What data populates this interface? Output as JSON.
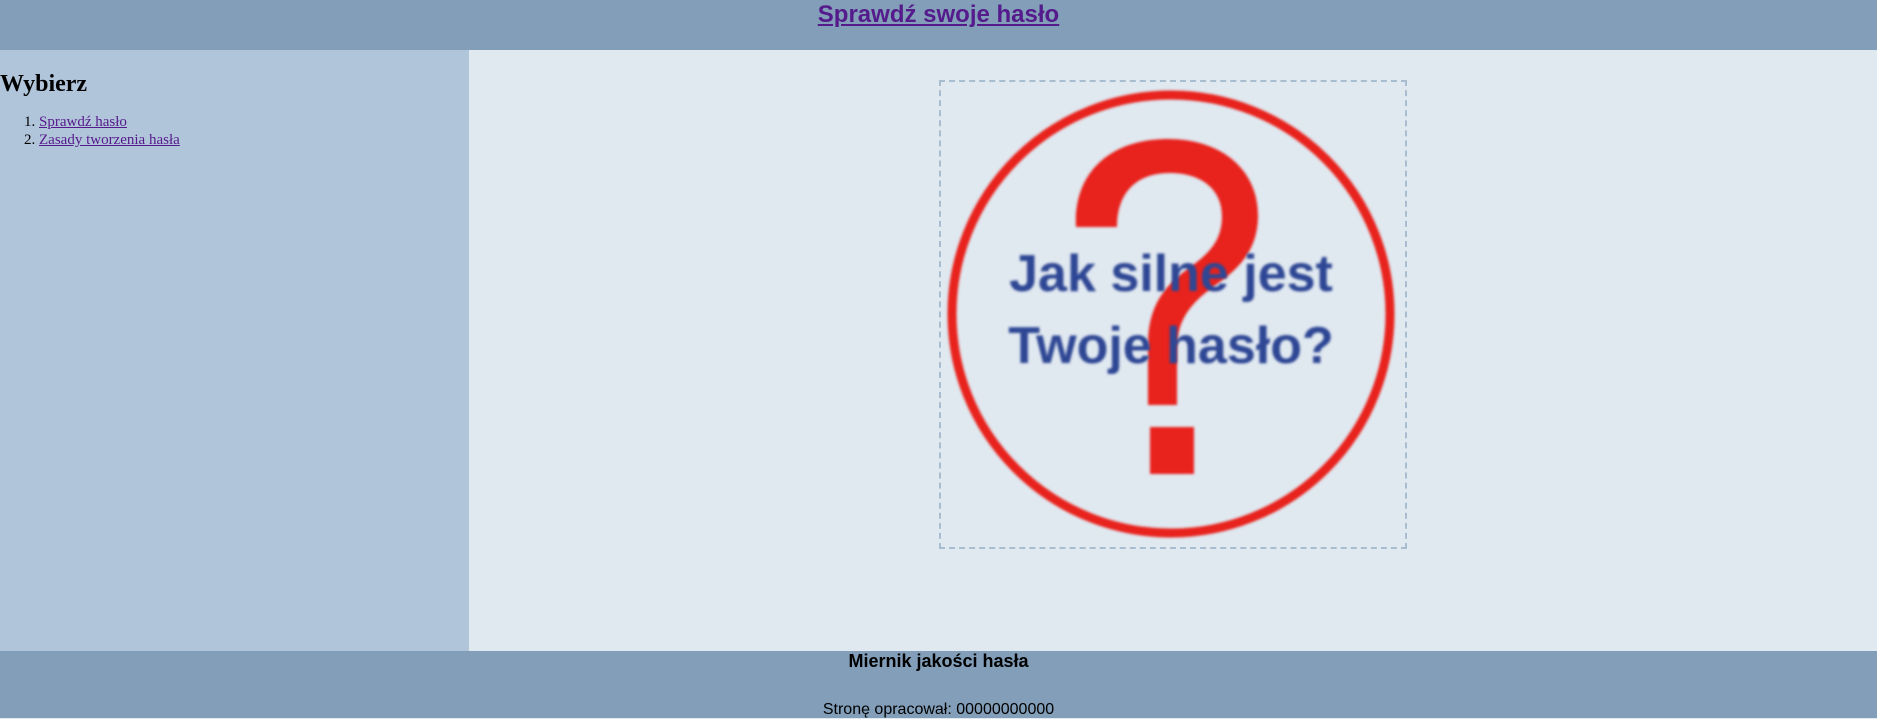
{
  "header": {
    "title": "Sprawdź swoje hasło"
  },
  "sidebar": {
    "heading": "Wybierz",
    "items": [
      {
        "label": "Sprawdź hasło"
      },
      {
        "label": "Zasady tworzenia hasła"
      }
    ]
  },
  "main": {
    "image": {
      "text_line1": "Jak silne jest",
      "text_line2": "Twoje hasło?",
      "symbol": "?",
      "ring_color": "#e8231a",
      "text_color": "#2e4694"
    }
  },
  "footer": {
    "title": "Miernik jakości hasła",
    "author": "Stronę opracował: 00000000000"
  },
  "colors": {
    "header_bg": "#829eb8",
    "sidebar_bg": "#b0c4da",
    "main_bg": "#e0e8f0",
    "link": "#551a8b"
  }
}
